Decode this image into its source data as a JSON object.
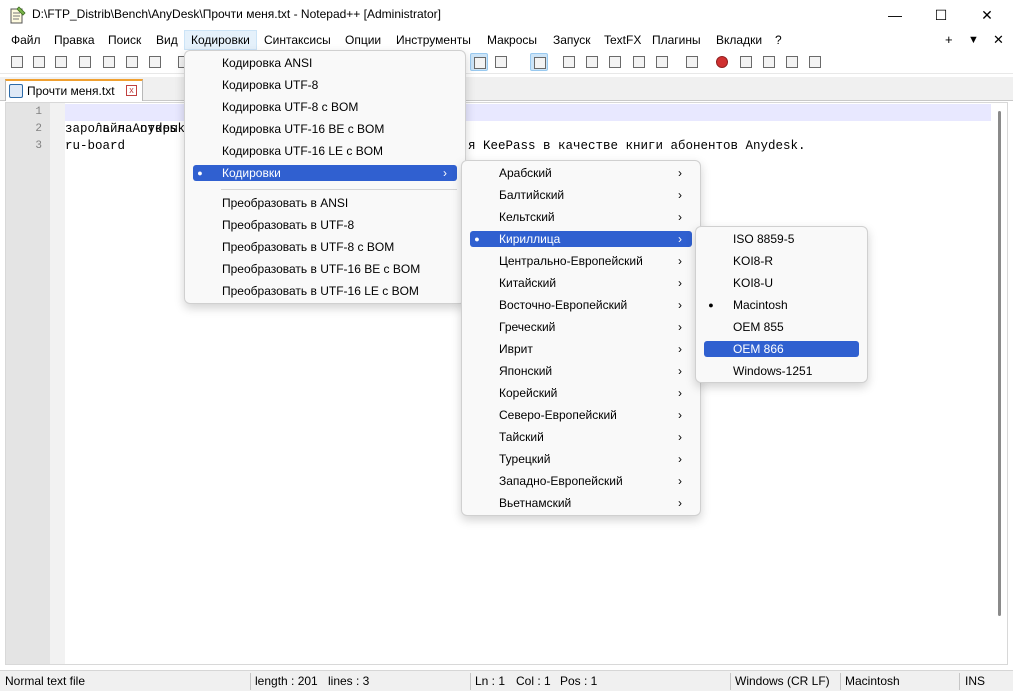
{
  "window": {
    "title": "D:\\FTP_Distrib\\Bench\\AnyDesk\\Прочти меня.txt - Notepad++ [Administrator]",
    "minimize": "—",
    "maximize": "☐",
    "close": "✕"
  },
  "menubar": {
    "items": [
      "Файл",
      "Правка",
      "Поиск",
      "Вид",
      "Кодировки",
      "Синтаксисы",
      "Опции",
      "Инструменты",
      "Макросы",
      "Запуск",
      "TextFX",
      "Плагины",
      "Вкладки",
      "?"
    ],
    "active": "Кодировки",
    "right_plus": "+",
    "right_down": "▼",
    "right_close": "✕"
  },
  "tab": {
    "label": "Прочти меня.txt",
    "close": "x"
  },
  "editor": {
    "line_numbers": [
      "1",
      "2",
      "3"
    ],
    "lines": [
      "Файл Anydesk.kdbx — база данных KeePass в качестве книги абонентов Anydesk.",
      "Пароль на открытие:",
      "ru-board"
    ],
    "visible_lines": [
      "ˆайл Anydesk.kd",
      "зароль на откры",
      "ru-board"
    ],
    "visible_line1_right": "я KeePass в качестве книги абонентов Anydesk."
  },
  "encoding_menu": {
    "items": [
      {
        "label": "Кодировка ANSI"
      },
      {
        "label": "Кодировка UTF-8"
      },
      {
        "label": "Кодировка UTF-8 с BOM"
      },
      {
        "label": "Кодировка UTF-16 BE с BOM"
      },
      {
        "label": "Кодировка UTF-16 LE с BOM"
      },
      {
        "label": "Кодировки",
        "submenu": true,
        "highlighted": true,
        "bullet": "●",
        "arrow": "›"
      }
    ],
    "convert_items": [
      {
        "label": "Преобразовать в ANSI"
      },
      {
        "label": "Преобразовать в UTF-8"
      },
      {
        "label": "Преобразовать в UTF-8 с BOM"
      },
      {
        "label": "Преобразовать в UTF-16 BE с BOM"
      },
      {
        "label": "Преобразовать в UTF-16 LE с BOM"
      }
    ]
  },
  "charset_menu": {
    "arrow": "›",
    "bullet": "●",
    "items": [
      {
        "label": "Арабский"
      },
      {
        "label": "Балтийский"
      },
      {
        "label": "Кельтский"
      },
      {
        "label": "Кириллица",
        "highlighted": true
      },
      {
        "label": "Центрально-Европейский"
      },
      {
        "label": "Китайский"
      },
      {
        "label": "Восточно-Европейский"
      },
      {
        "label": "Греческий"
      },
      {
        "label": "Иврит"
      },
      {
        "label": "Японский"
      },
      {
        "label": "Корейский"
      },
      {
        "label": "Северо-Европейский"
      },
      {
        "label": "Тайский"
      },
      {
        "label": "Турецкий"
      },
      {
        "label": "Западно-Европейский"
      },
      {
        "label": "Вьетнамский"
      }
    ]
  },
  "cyrillic_menu": {
    "bullet": "●",
    "items": [
      {
        "label": "ISO 8859-5"
      },
      {
        "label": "KOI8-R"
      },
      {
        "label": "KOI8-U"
      },
      {
        "label": "Macintosh",
        "checked": true
      },
      {
        "label": "OEM 855"
      },
      {
        "label": "OEM 866",
        "highlighted": true
      },
      {
        "label": "Windows-1251"
      }
    ]
  },
  "statusbar": {
    "file_type": "Normal text file",
    "length": "length : 201",
    "lines": "lines : 3",
    "ln": "Ln : 1",
    "col": "Col : 1",
    "pos": "Pos : 1",
    "eol": "Windows (CR LF)",
    "encoding": "Macintosh",
    "mode": "INS"
  },
  "colors": {
    "highlight": "#3060d0",
    "current_line": "#e8e8ff",
    "tab_accent": "#f0a030"
  }
}
